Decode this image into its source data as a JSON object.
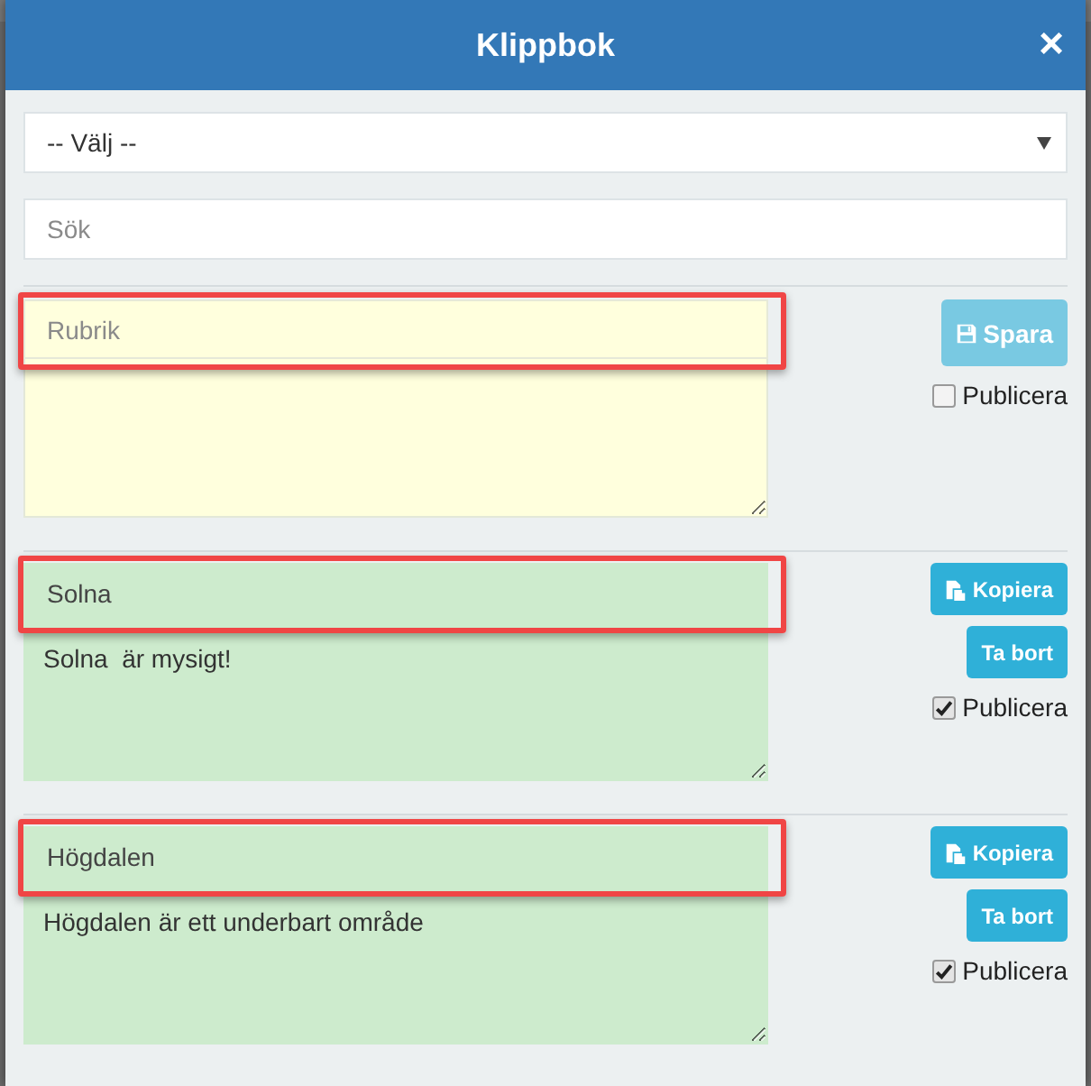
{
  "dialog": {
    "title": "Klippbok",
    "close": "×"
  },
  "category_select": {
    "value": "-- Välj --"
  },
  "search": {
    "placeholder": "Sök"
  },
  "entries": [
    {
      "kind": "new",
      "title": {
        "placeholder": "Rubrik"
      },
      "highlighted": true,
      "buttons": [
        {
          "kind": "save",
          "label": "Spara",
          "disabled": true
        }
      ],
      "publish": {
        "label": "Publicera",
        "checked": false
      }
    },
    {
      "kind": "saved",
      "title": {
        "value": "Solna"
      },
      "body": "Solna  är mysigt!",
      "highlighted": true,
      "buttons": [
        {
          "kind": "copy",
          "label": "Kopiera",
          "disabled": false
        },
        {
          "kind": "delete",
          "label": "Ta bort",
          "disabled": false
        }
      ],
      "publish": {
        "label": "Publicera",
        "checked": true
      }
    },
    {
      "kind": "saved",
      "title": {
        "value": "Högdalen"
      },
      "body": "Högdalen är ett underbart område",
      "highlighted": true,
      "buttons": [
        {
          "kind": "copy",
          "label": "Kopiera",
          "disabled": false
        },
        {
          "kind": "delete",
          "label": "Ta bort",
          "disabled": false
        }
      ],
      "publish": {
        "label": "Publicera",
        "checked": true
      }
    }
  ]
}
